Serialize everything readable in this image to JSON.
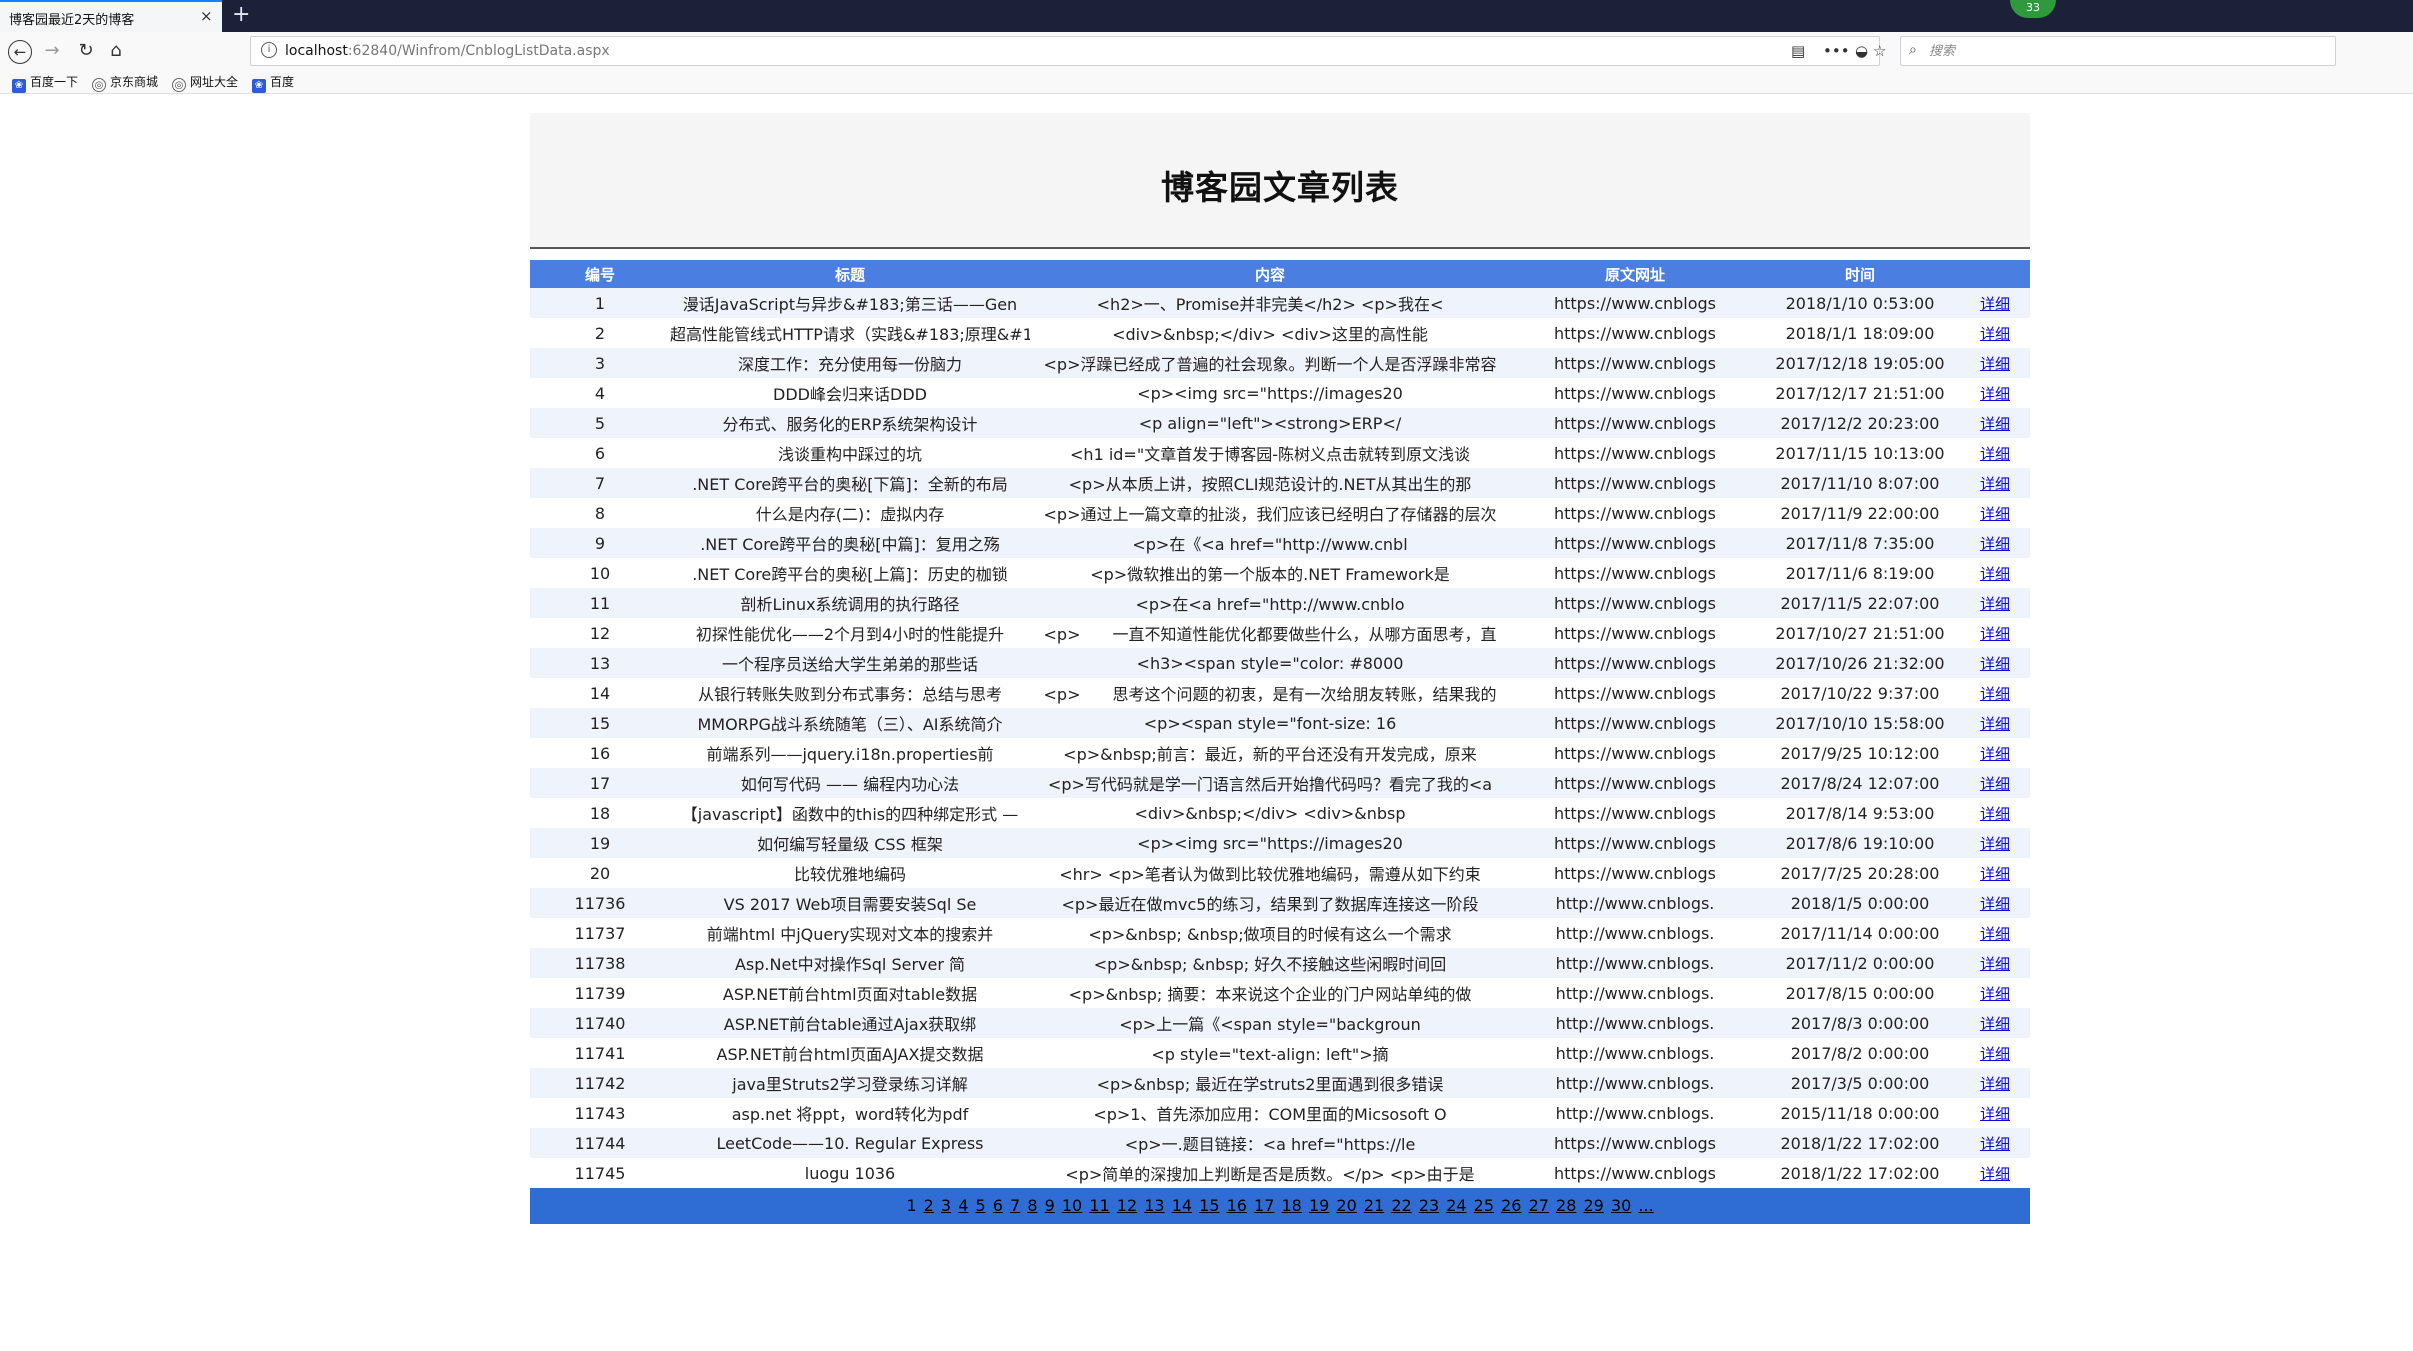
{
  "browser": {
    "tab_title": "博客园最近2天的博客",
    "tab_close": "×",
    "new_tab": "+",
    "extension_badge": "33",
    "url_host": "localhost",
    "url_path": ":62840/Winfrom/CnblogListData.aspx",
    "search_placeholder": "搜索",
    "bookmarks": [
      "百度一下",
      "京东商城",
      "网址大全",
      "百度"
    ]
  },
  "page": {
    "title": "博客园文章列表"
  },
  "table": {
    "headers": [
      "编号",
      "标题",
      "内容",
      "原文网址",
      "时间",
      ""
    ],
    "detail_label": "详细",
    "rows": [
      {
        "id": "1",
        "title": "漫话JavaScript与异步&#183;第三话——Gen",
        "content": "<h2>一、Promise并非完美</h2> <p>我在<",
        "url": "https://www.cnblogs",
        "time": "2018/1/10 0:53:00"
      },
      {
        "id": "2",
        "title": "超高性能管线式HTTP请求（实践&#183;原理&#183",
        "content": "<div>&nbsp;</div> <div>这里的高性能",
        "url": "https://www.cnblogs",
        "time": "2018/1/1 18:09:00"
      },
      {
        "id": "3",
        "title": "深度工作：充分使用每一份脑力",
        "content": "<p>浮躁已经成了普遍的社会现象。判断一个人是否浮躁非常容",
        "url": "https://www.cnblogs",
        "time": "2017/12/18 19:05:00"
      },
      {
        "id": "4",
        "title": "DDD峰会归来话DDD",
        "content": "<p><img src=\"https://images20",
        "url": "https://www.cnblogs",
        "time": "2017/12/17 21:51:00"
      },
      {
        "id": "5",
        "title": "分布式、服务化的ERP系统架构设计",
        "content": "<p align=\"left\"><strong>ERP</",
        "url": "https://www.cnblogs",
        "time": "2017/12/2 20:23:00"
      },
      {
        "id": "6",
        "title": "浅谈重构中踩过的坑",
        "content": "<h1 id=\"文章首发于博客园-陈树义点击就转到原文浅谈",
        "url": "https://www.cnblogs",
        "time": "2017/11/15 10:13:00"
      },
      {
        "id": "7",
        "title": ".NET Core跨平台的奥秘[下篇]：全新的布局",
        "content": "<p>从本质上讲，按照CLI规范设计的.NET从其出生的那",
        "url": "https://www.cnblogs",
        "time": "2017/11/10 8:07:00"
      },
      {
        "id": "8",
        "title": "什么是内存(二)：虚拟内存",
        "content": "<p>通过上一篇文章的扯淡，我们应该已经明白了存储器的层次",
        "url": "https://www.cnblogs",
        "time": "2017/11/9 22:00:00"
      },
      {
        "id": "9",
        "title": ".NET Core跨平台的奥秘[中篇]：复用之殇",
        "content": "<p>在《<a href=\"http://www.cnbl",
        "url": "https://www.cnblogs",
        "time": "2017/11/8 7:35:00"
      },
      {
        "id": "10",
        "title": ".NET Core跨平台的奥秘[上篇]：历史的枷锁",
        "content": "<p>微软推出的第一个版本的.NET Framework是",
        "url": "https://www.cnblogs",
        "time": "2017/11/6 8:19:00"
      },
      {
        "id": "11",
        "title": "剖析Linux系统调用的执行路径",
        "content": "<p>在<a href=\"http://www.cnblo",
        "url": "https://www.cnblogs",
        "time": "2017/11/5 22:07:00"
      },
      {
        "id": "12",
        "title": "初探性能优化——2个月到4小时的性能提升",
        "content": "<p>　　一直不知道性能优化都要做些什么，从哪方面思考，直",
        "url": "https://www.cnblogs",
        "time": "2017/10/27 21:51:00"
      },
      {
        "id": "13",
        "title": "一个程序员送给大学生弟弟的那些话",
        "content": "<h3><span style=\"color: #8000",
        "url": "https://www.cnblogs",
        "time": "2017/10/26 21:32:00"
      },
      {
        "id": "14",
        "title": "从银行转账失败到分布式事务：总结与思考",
        "content": "<p>　　思考这个问题的初衷，是有一次给朋友转账，结果我的",
        "url": "https://www.cnblogs",
        "time": "2017/10/22 9:37:00"
      },
      {
        "id": "15",
        "title": "MMORPG战斗系统随笔（三）、AI系统简介",
        "content": "<p><span style=\"font-size: 16",
        "url": "https://www.cnblogs",
        "time": "2017/10/10 15:58:00"
      },
      {
        "id": "16",
        "title": "前端系列——jquery.i18n.properties前",
        "content": "<p>&nbsp;前言：最近，新的平台还没有开发完成，原来",
        "url": "https://www.cnblogs",
        "time": "2017/9/25 10:12:00"
      },
      {
        "id": "17",
        "title": "如何写代码 —— 编程内功心法",
        "content": "<p>写代码就是学一门语言然后开始撸代码吗？看完了我的<a",
        "url": "https://www.cnblogs",
        "time": "2017/8/24 12:07:00"
      },
      {
        "id": "18",
        "title": "【javascript】函数中的this的四种绑定形式 —",
        "content": "<div>&nbsp;</div> <div>&nbsp",
        "url": "https://www.cnblogs",
        "time": "2017/8/14 9:53:00"
      },
      {
        "id": "19",
        "title": "如何编写轻量级 CSS 框架",
        "content": "<p><img src=\"https://images20",
        "url": "https://www.cnblogs",
        "time": "2017/8/6 19:10:00"
      },
      {
        "id": "20",
        "title": "比较优雅地编码",
        "content": "<hr> <p>笔者认为做到比较优雅地编码，需遵从如下约束",
        "url": "https://www.cnblogs",
        "time": "2017/7/25 20:28:00"
      },
      {
        "id": "11736",
        "title": "VS 2017 Web项目需要安装Sql Se",
        "content": "<p>最近在做mvc5的练习，结果到了数据库连接这一阶段",
        "url": "http://www.cnblogs.",
        "time": "2018/1/5 0:00:00"
      },
      {
        "id": "11737",
        "title": "前端html 中jQuery实现对文本的搜索并",
        "content": "<p>&nbsp; &nbsp;做项目的时候有这么一个需求",
        "url": "http://www.cnblogs.",
        "time": "2017/11/14 0:00:00"
      },
      {
        "id": "11738",
        "title": "Asp.Net中对操作Sql Server 简",
        "content": "<p>&nbsp; &nbsp; 好久不接触这些闲暇时间回",
        "url": "http://www.cnblogs.",
        "time": "2017/11/2 0:00:00"
      },
      {
        "id": "11739",
        "title": "ASP.NET前台html页面对table数据",
        "content": "<p>&nbsp; 摘要：本来说这个企业的门户网站单纯的做",
        "url": "http://www.cnblogs.",
        "time": "2017/8/15 0:00:00"
      },
      {
        "id": "11740",
        "title": "ASP.NET前台table通过Ajax获取绑",
        "content": "<p>上一篇《<span style=\"backgroun",
        "url": "http://www.cnblogs.",
        "time": "2017/8/3 0:00:00"
      },
      {
        "id": "11741",
        "title": "ASP.NET前台html页面AJAX提交数据",
        "content": "<p style=\"text-align: left\">摘",
        "url": "http://www.cnblogs.",
        "time": "2017/8/2 0:00:00"
      },
      {
        "id": "11742",
        "title": "java里Struts2学习登录练习详解",
        "content": "<p>&nbsp; 最近在学struts2里面遇到很多错误",
        "url": "http://www.cnblogs.",
        "time": "2017/3/5 0:00:00"
      },
      {
        "id": "11743",
        "title": "asp.net 将ppt，word转化为pdf",
        "content": "<p>1、首先添加应用：COM里面的Micsosoft O",
        "url": "http://www.cnblogs.",
        "time": "2015/11/18 0:00:00"
      },
      {
        "id": "11744",
        "title": "LeetCode——10. Regular Express",
        "content": "<p>一.题目链接：<a href=\"https://le",
        "url": "https://www.cnblogs",
        "time": "2018/1/22 17:02:00"
      },
      {
        "id": "11745",
        "title": "luogu 1036",
        "content": "<p>简单的深搜加上判断是否是质数。</p> <p>由于是",
        "url": "https://www.cnblogs",
        "time": "2018/1/22 17:02:00"
      }
    ]
  },
  "pager": {
    "current": "1",
    "pages": [
      "2",
      "3",
      "4",
      "5",
      "6",
      "7",
      "8",
      "9",
      "10",
      "11",
      "12",
      "13",
      "14",
      "15",
      "16",
      "17",
      "18",
      "19",
      "20",
      "21",
      "22",
      "23",
      "24",
      "25",
      "26",
      "27",
      "28",
      "29",
      "30"
    ],
    "more": "..."
  },
  "colors": {
    "header_bg": "#4a7ee0",
    "pager_bg": "#2f6dd4",
    "row_alt": "#eff3fb",
    "link": "#0b0bd6"
  }
}
